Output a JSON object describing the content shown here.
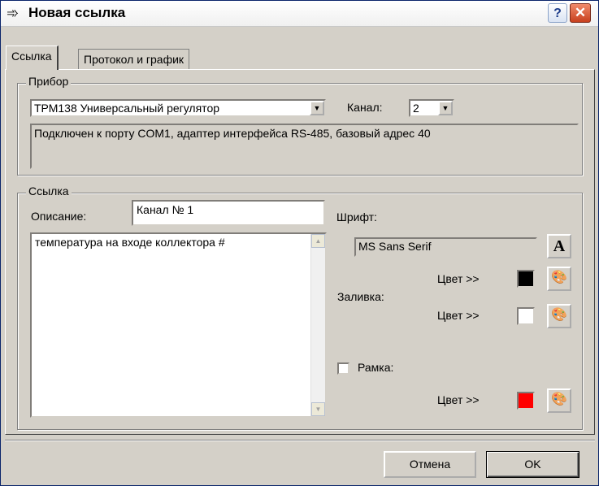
{
  "window": {
    "title": "Новая ссылка",
    "help_label": "?",
    "close_label": "✕"
  },
  "tabs": [
    {
      "label": "Ссылка"
    },
    {
      "label": "Протокол и график"
    }
  ],
  "device": {
    "group_label": "Прибор",
    "selected_device": "ТРМ138 Универсальный регулятор",
    "channel_label": "Канал:",
    "channel_value": "2",
    "info": "Подключен к порту COM1, адаптер интерфейса RS-485, базовый адрес 40"
  },
  "link": {
    "group_label": "Ссылка",
    "description_label": "Описание:",
    "description_value": "Канал № 1",
    "text": "температура на входе коллектора #",
    "font_label": "Шрифт:",
    "font_value": "MS Sans Serif",
    "font_button": "A",
    "color_label": "Цвет >>",
    "fill_label": "Заливка:",
    "frame_label": "Рамка:",
    "text_color": "#000000",
    "fill_color": "#ffffff",
    "frame_color": "#ff0000"
  },
  "buttons": {
    "cancel": "Отмена",
    "ok": "OK"
  }
}
